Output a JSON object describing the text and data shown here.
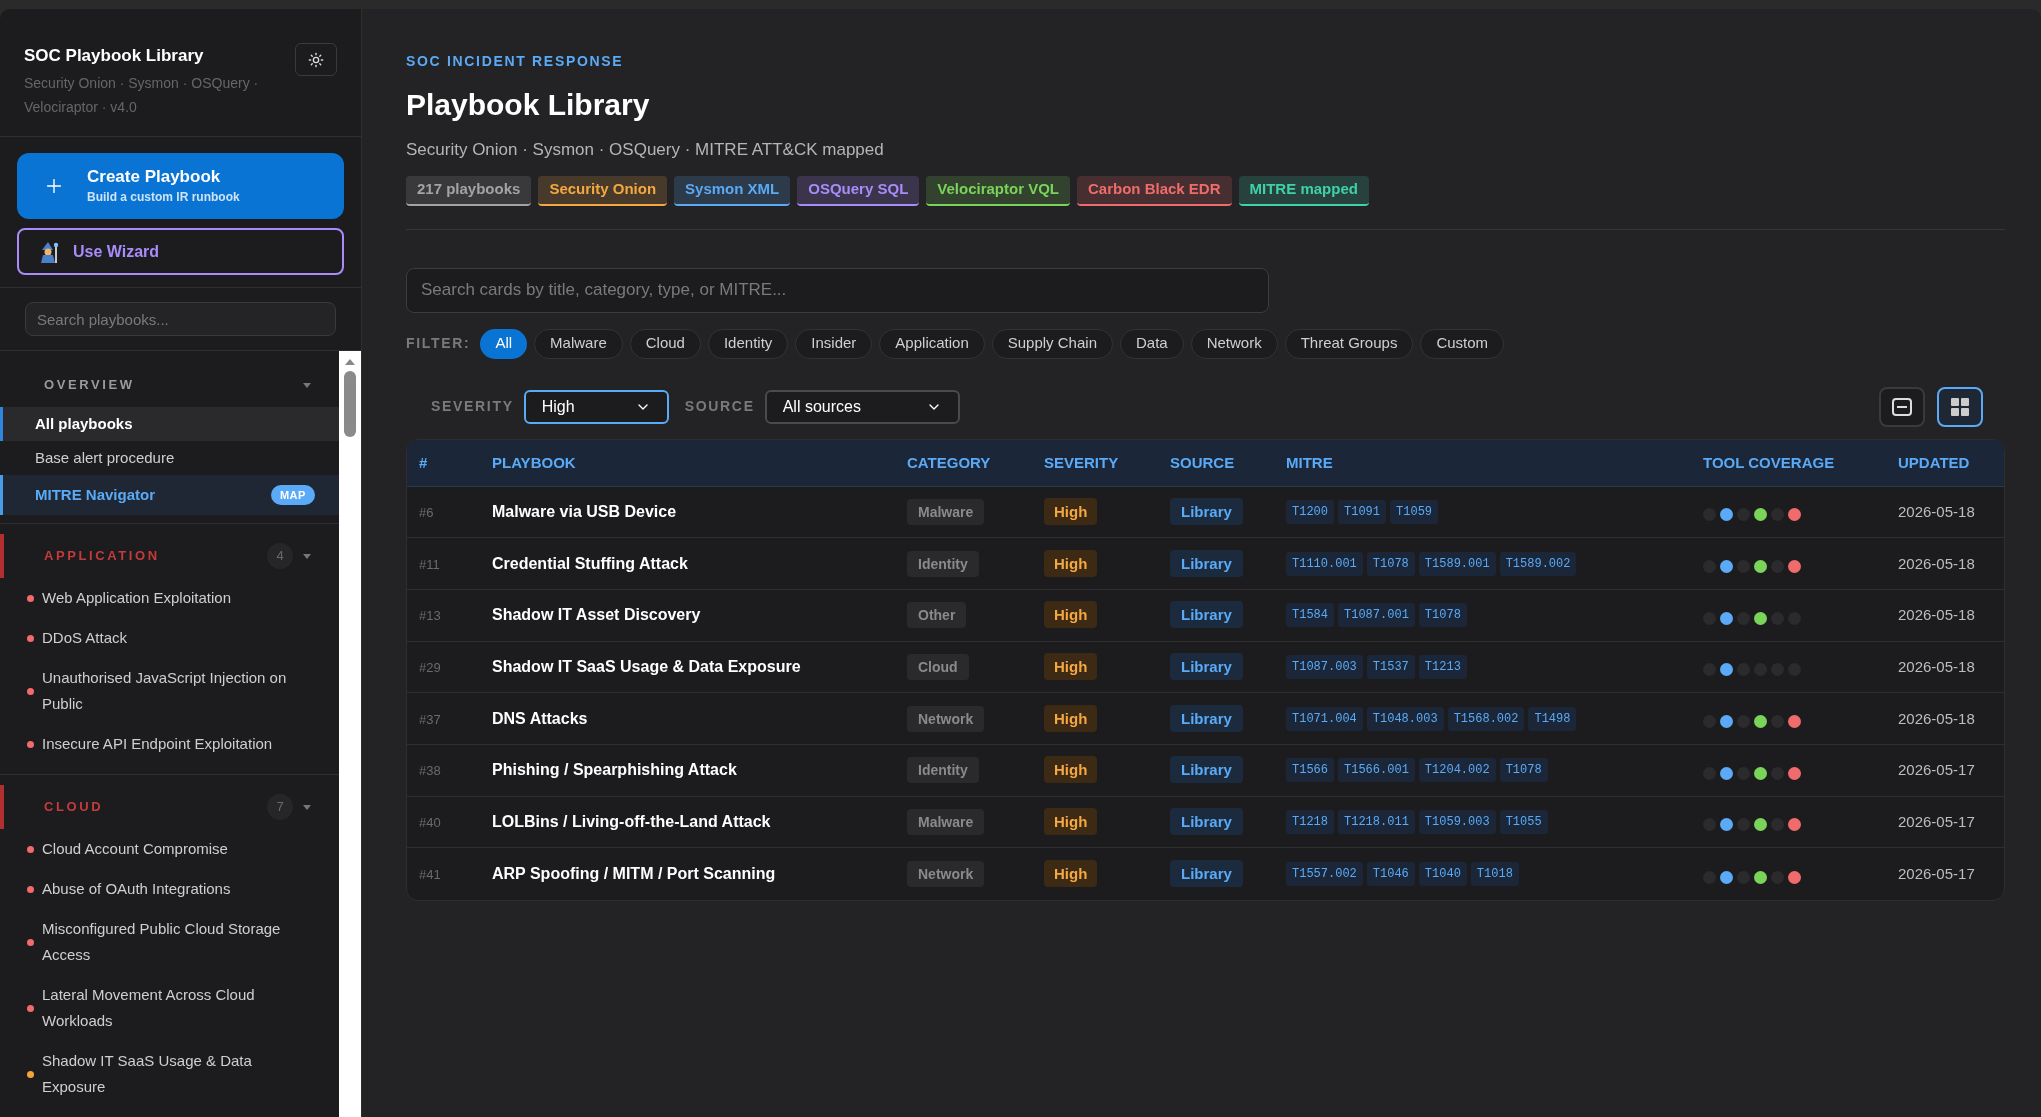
{
  "sidebar": {
    "title": "SOC Playbook Library",
    "subtitle": "Security Onion · Sysmon · OSQuery · Velociraptor · v4.0",
    "create_button": {
      "label": "Create Playbook",
      "sublabel": "Build a custom IR runbook"
    },
    "wizard_button": {
      "label": "Use Wizard"
    },
    "search": {
      "placeholder": "Search playbooks..."
    },
    "groups": [
      {
        "title": "OVERVIEW",
        "kind": "overview",
        "expanded": true,
        "items": [
          {
            "label": "All playbooks",
            "kind": "link",
            "selected": true
          },
          {
            "label": "Base alert procedure",
            "kind": "link",
            "selected": false
          },
          {
            "label": "MITRE Navigator",
            "kind": "tool",
            "selected": false,
            "badge": "MAP"
          }
        ]
      },
      {
        "title": "APPLICATION",
        "kind": "category",
        "count": "4",
        "expanded": true,
        "items": [
          {
            "label": "Web Application Exploitation",
            "kind": "playbook",
            "color": "#f26b6b"
          },
          {
            "label": "DDoS Attack",
            "kind": "playbook",
            "color": "#f26b6b"
          },
          {
            "label": "Unauthorised JavaScript Injection on Public",
            "kind": "playbook",
            "color": "#f26b6b"
          },
          {
            "label": "Insecure API Endpoint Exploitation",
            "kind": "playbook",
            "color": "#f26b6b"
          }
        ]
      },
      {
        "title": "CLOUD",
        "kind": "category",
        "count": "7",
        "expanded": true,
        "items": [
          {
            "label": "Cloud Account Compromise",
            "kind": "playbook",
            "color": "#f26b6b"
          },
          {
            "label": "Abuse of OAuth Integrations",
            "kind": "playbook",
            "color": "#f26b6b"
          },
          {
            "label": "Misconfigured Public Cloud Storage Access",
            "kind": "playbook",
            "color": "#f26b6b"
          },
          {
            "label": "Lateral Movement Across Cloud Workloads",
            "kind": "playbook",
            "color": "#f26b6b"
          },
          {
            "label": "Shadow IT SaaS Usage & Data Exposure",
            "kind": "playbook",
            "color": "#f5a23a"
          }
        ]
      }
    ]
  },
  "header": {
    "eyebrow": "SOC INCIDENT RESPONSE",
    "title": "Playbook Library",
    "subtitle": "Security Onion · Sysmon · OSQuery · MITRE ATT&CK mapped",
    "tags": [
      {
        "label": "217 playbooks",
        "color": "#a3a3a3"
      },
      {
        "label": "Security Onion",
        "color": "#f5a742"
      },
      {
        "label": "Sysmon XML",
        "color": "#5aa9f5"
      },
      {
        "label": "OSQuery SQL",
        "color": "#a98bfa"
      },
      {
        "label": "Velociraptor VQL",
        "color": "#7ad45a"
      },
      {
        "label": "Carbon Black EDR",
        "color": "#f06b6b"
      },
      {
        "label": "MITRE mapped",
        "color": "#3fd1a8"
      }
    ]
  },
  "search": {
    "placeholder": "Search cards by title, category, type, or MITRE..."
  },
  "filter": {
    "label": "FILTER:",
    "options": [
      {
        "label": "All",
        "selected": true
      },
      {
        "label": "Malware",
        "selected": false
      },
      {
        "label": "Cloud",
        "selected": false
      },
      {
        "label": "Identity",
        "selected": false
      },
      {
        "label": "Insider",
        "selected": false
      },
      {
        "label": "Application",
        "selected": false
      },
      {
        "label": "Supply Chain",
        "selected": false
      },
      {
        "label": "Data",
        "selected": false
      },
      {
        "label": "Network",
        "selected": false
      },
      {
        "label": "Threat Groups",
        "selected": false
      },
      {
        "label": "Custom",
        "selected": false
      }
    ]
  },
  "severity_select": {
    "label": "SEVERITY",
    "value": "High",
    "focused": true
  },
  "source_select": {
    "label": "SOURCE",
    "value": "All sources",
    "focused": false
  },
  "view_toggle": [
    {
      "kind": "list",
      "selected": false
    },
    {
      "kind": "grid",
      "selected": true
    }
  ],
  "table": {
    "columns": [
      "#",
      "PLAYBOOK",
      "CATEGORY",
      "SEVERITY",
      "SOURCE",
      "MITRE",
      "TOOL COVERAGE",
      "UPDATED"
    ],
    "rows": [
      {
        "id": "#6",
        "playbook": "Malware via USB Device",
        "category": "Malware",
        "severity": "High",
        "source": "Library",
        "mitre": [
          "T1200",
          "T1091",
          "T1059"
        ],
        "coverage": [
          {
            "color": "#2b2b2d"
          },
          {
            "color": "#5aaaf7"
          },
          {
            "color": "#2b2b2d"
          },
          {
            "color": "#7ad45a"
          },
          {
            "color": "#2b2b2d"
          },
          {
            "color": "#f06b6b"
          }
        ],
        "updated": "2026-05-18"
      },
      {
        "id": "#11",
        "playbook": "Credential Stuffing Attack",
        "category": "Identity",
        "severity": "High",
        "source": "Library",
        "mitre": [
          "T1110.001",
          "T1078",
          "T1589.001",
          "T1589.002"
        ],
        "coverage": [
          {
            "color": "#2b2b2d"
          },
          {
            "color": "#5aaaf7"
          },
          {
            "color": "#2b2b2d"
          },
          {
            "color": "#7ad45a"
          },
          {
            "color": "#2b2b2d"
          },
          {
            "color": "#f06b6b"
          }
        ],
        "updated": "2026-05-18"
      },
      {
        "id": "#13",
        "playbook": "Shadow IT Asset Discovery",
        "category": "Other",
        "severity": "High",
        "source": "Library",
        "mitre": [
          "T1584",
          "T1087.001",
          "T1078"
        ],
        "coverage": [
          {
            "color": "#2b2b2d"
          },
          {
            "color": "#5aaaf7"
          },
          {
            "color": "#2b2b2d"
          },
          {
            "color": "#7ad45a"
          },
          {
            "color": "#2b2b2d"
          },
          {
            "color": "#2b2b2d"
          }
        ],
        "updated": "2026-05-18"
      },
      {
        "id": "#29",
        "playbook": "Shadow IT SaaS Usage & Data Exposure",
        "category": "Cloud",
        "severity": "High",
        "source": "Library",
        "mitre": [
          "T1087.003",
          "T1537",
          "T1213"
        ],
        "coverage": [
          {
            "color": "#2b2b2d"
          },
          {
            "color": "#5aaaf7"
          },
          {
            "color": "#2b2b2d"
          },
          {
            "color": "#2b2b2d"
          },
          {
            "color": "#2b2b2d"
          },
          {
            "color": "#2b2b2d"
          }
        ],
        "updated": "2026-05-18"
      },
      {
        "id": "#37",
        "playbook": "DNS Attacks",
        "category": "Network",
        "severity": "High",
        "source": "Library",
        "mitre": [
          "T1071.004",
          "T1048.003",
          "T1568.002",
          "T1498"
        ],
        "coverage": [
          {
            "color": "#2b2b2d"
          },
          {
            "color": "#5aaaf7"
          },
          {
            "color": "#2b2b2d"
          },
          {
            "color": "#7ad45a"
          },
          {
            "color": "#2b2b2d"
          },
          {
            "color": "#f06b6b"
          }
        ],
        "updated": "2026-05-18"
      },
      {
        "id": "#38",
        "playbook": "Phishing / Spearphishing Attack",
        "category": "Identity",
        "severity": "High",
        "source": "Library",
        "mitre": [
          "T1566",
          "T1566.001",
          "T1204.002",
          "T1078"
        ],
        "coverage": [
          {
            "color": "#2b2b2d"
          },
          {
            "color": "#5aaaf7"
          },
          {
            "color": "#2b2b2d"
          },
          {
            "color": "#7ad45a"
          },
          {
            "color": "#2b2b2d"
          },
          {
            "color": "#f06b6b"
          }
        ],
        "updated": "2026-05-17"
      },
      {
        "id": "#40",
        "playbook": "LOLBins / Living-off-the-Land Attack",
        "category": "Malware",
        "severity": "High",
        "source": "Library",
        "mitre": [
          "T1218",
          "T1218.011",
          "T1059.003",
          "T1055"
        ],
        "coverage": [
          {
            "color": "#2b2b2d"
          },
          {
            "color": "#5aaaf7"
          },
          {
            "color": "#2b2b2d"
          },
          {
            "color": "#7ad45a"
          },
          {
            "color": "#2b2b2d"
          },
          {
            "color": "#f06b6b"
          }
        ],
        "updated": "2026-05-17"
      },
      {
        "id": "#41",
        "playbook": "ARP Spoofing / MITM / Port Scanning",
        "category": "Network",
        "severity": "High",
        "source": "Library",
        "mitre": [
          "T1557.002",
          "T1046",
          "T1040",
          "T1018"
        ],
        "coverage": [
          {
            "color": "#2b2b2d"
          },
          {
            "color": "#5aaaf7"
          },
          {
            "color": "#2b2b2d"
          },
          {
            "color": "#7ad45a"
          },
          {
            "color": "#2b2b2d"
          },
          {
            "color": "#f06b6b"
          }
        ],
        "updated": "2026-05-17"
      }
    ]
  }
}
